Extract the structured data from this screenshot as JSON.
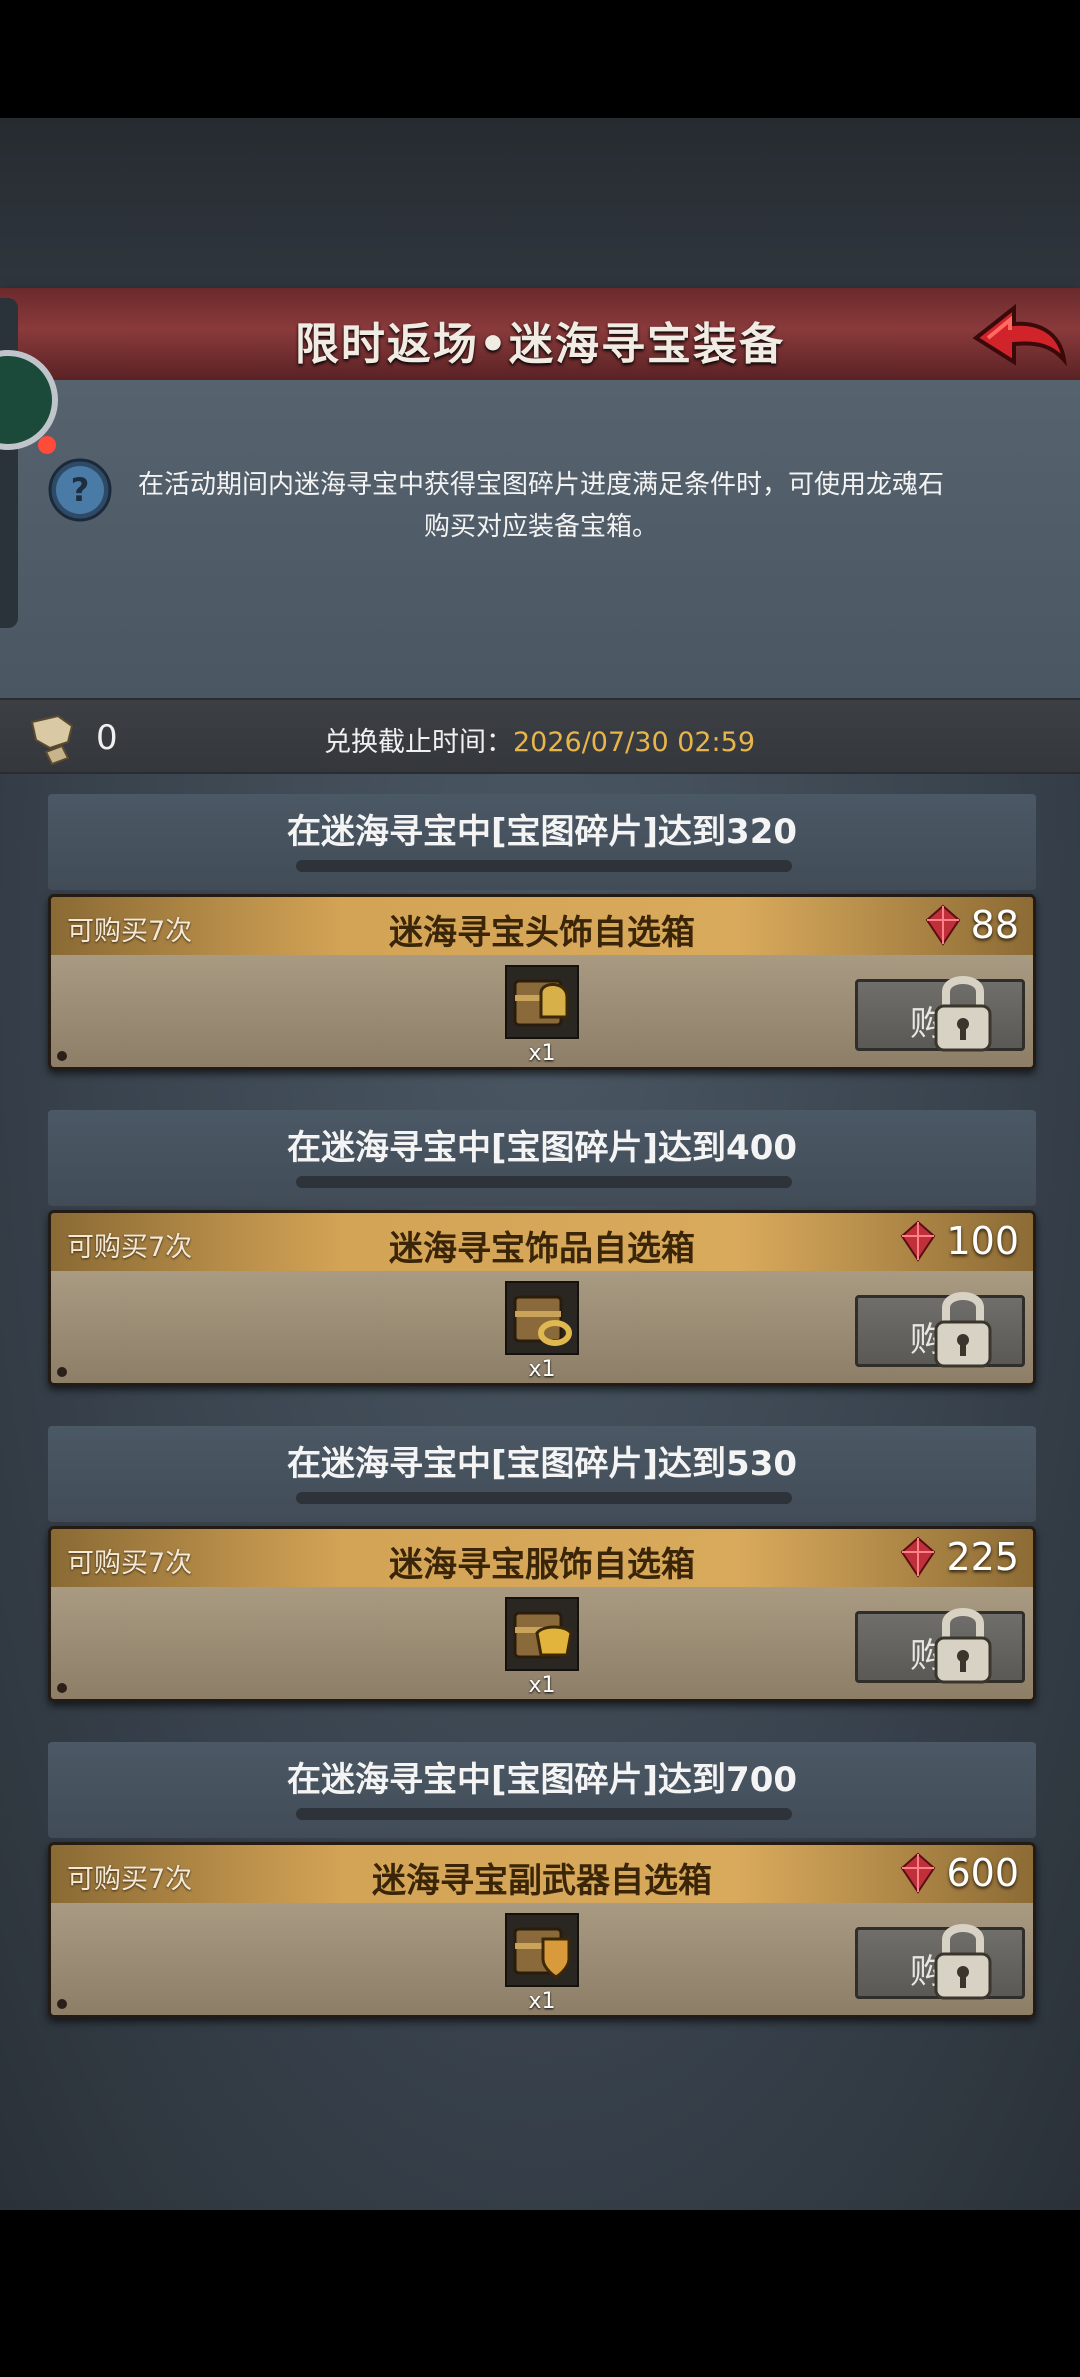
{
  "header": {
    "title": "限时返场•迷海寻宝装备"
  },
  "help": {
    "text": "在活动期间内迷海寻宝中获得宝图碎片进度满足条件时，可使用龙魂石购买对应装备宝箱。"
  },
  "info": {
    "map_piece_count": "0",
    "deadline_label": "兑换截止时间：",
    "deadline_value": "2026/07/30 02:59"
  },
  "groups": [
    {
      "requirement": "在迷海寻宝中[宝图碎片]达到320",
      "limit": "可购买7次",
      "name": "迷海寻宝头饰自选箱",
      "price": "88",
      "qty": "x1",
      "buy_label": "购",
      "icon": "chest-helmet-icon"
    },
    {
      "requirement": "在迷海寻宝中[宝图碎片]达到400",
      "limit": "可购买7次",
      "name": "迷海寻宝饰品自选箱",
      "price": "100",
      "qty": "x1",
      "buy_label": "购",
      "icon": "chest-ring-icon"
    },
    {
      "requirement": "在迷海寻宝中[宝图碎片]达到530",
      "limit": "可购买7次",
      "name": "迷海寻宝服饰自选箱",
      "price": "225",
      "qty": "x1",
      "buy_label": "购",
      "icon": "chest-armor-icon"
    },
    {
      "requirement": "在迷海寻宝中[宝图碎片]达到700",
      "limit": "可购买7次",
      "name": "迷海寻宝副武器自选箱",
      "price": "600",
      "qty": "x1",
      "buy_label": "购",
      "icon": "chest-shield-icon"
    }
  ],
  "colors": {
    "title_bar": "#8a3a3b",
    "card_header": "#d4a456",
    "deadline_value": "#e8b54a",
    "gem": "#c0303a"
  }
}
